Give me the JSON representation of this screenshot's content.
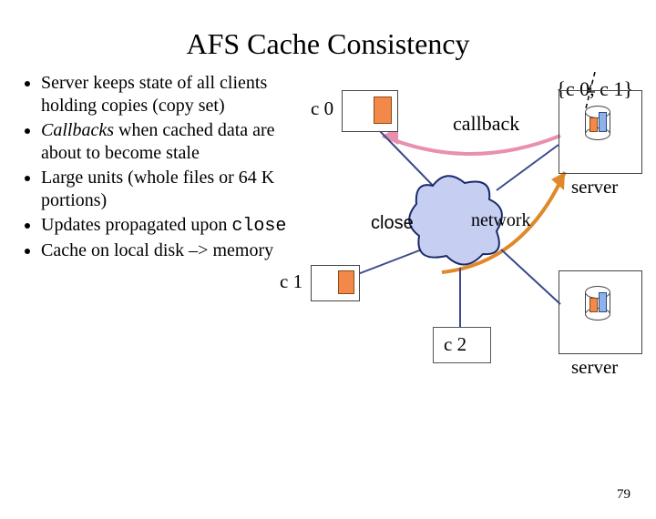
{
  "title": "AFS Cache Consistency",
  "copy_set_annotation": "{c 0, c 1}",
  "bullets": {
    "items": [
      {
        "text_before": "Server keeps state of all clients holding copies (copy set)",
        "italic_word": "",
        "text_after": ""
      },
      {
        "text_before": "",
        "italic_word": "Callbacks",
        "text_after": " when cached data are about to become stale"
      },
      {
        "text_before": "Large units (whole files or 64 K portions)",
        "italic_word": "",
        "text_after": ""
      },
      {
        "text_before": "Updates propagated upon ",
        "italic_word": "",
        "text_after": "",
        "mono": "close"
      },
      {
        "text_before": "Cache on local disk –> memory",
        "italic_word": "",
        "text_after": ""
      }
    ]
  },
  "diagram": {
    "client0": "c 0",
    "client1": "c 1",
    "client2": "c 2",
    "callback": "callback",
    "close": "close",
    "network": "network",
    "server_a": "server",
    "server_b": "server"
  },
  "page_number": "79"
}
